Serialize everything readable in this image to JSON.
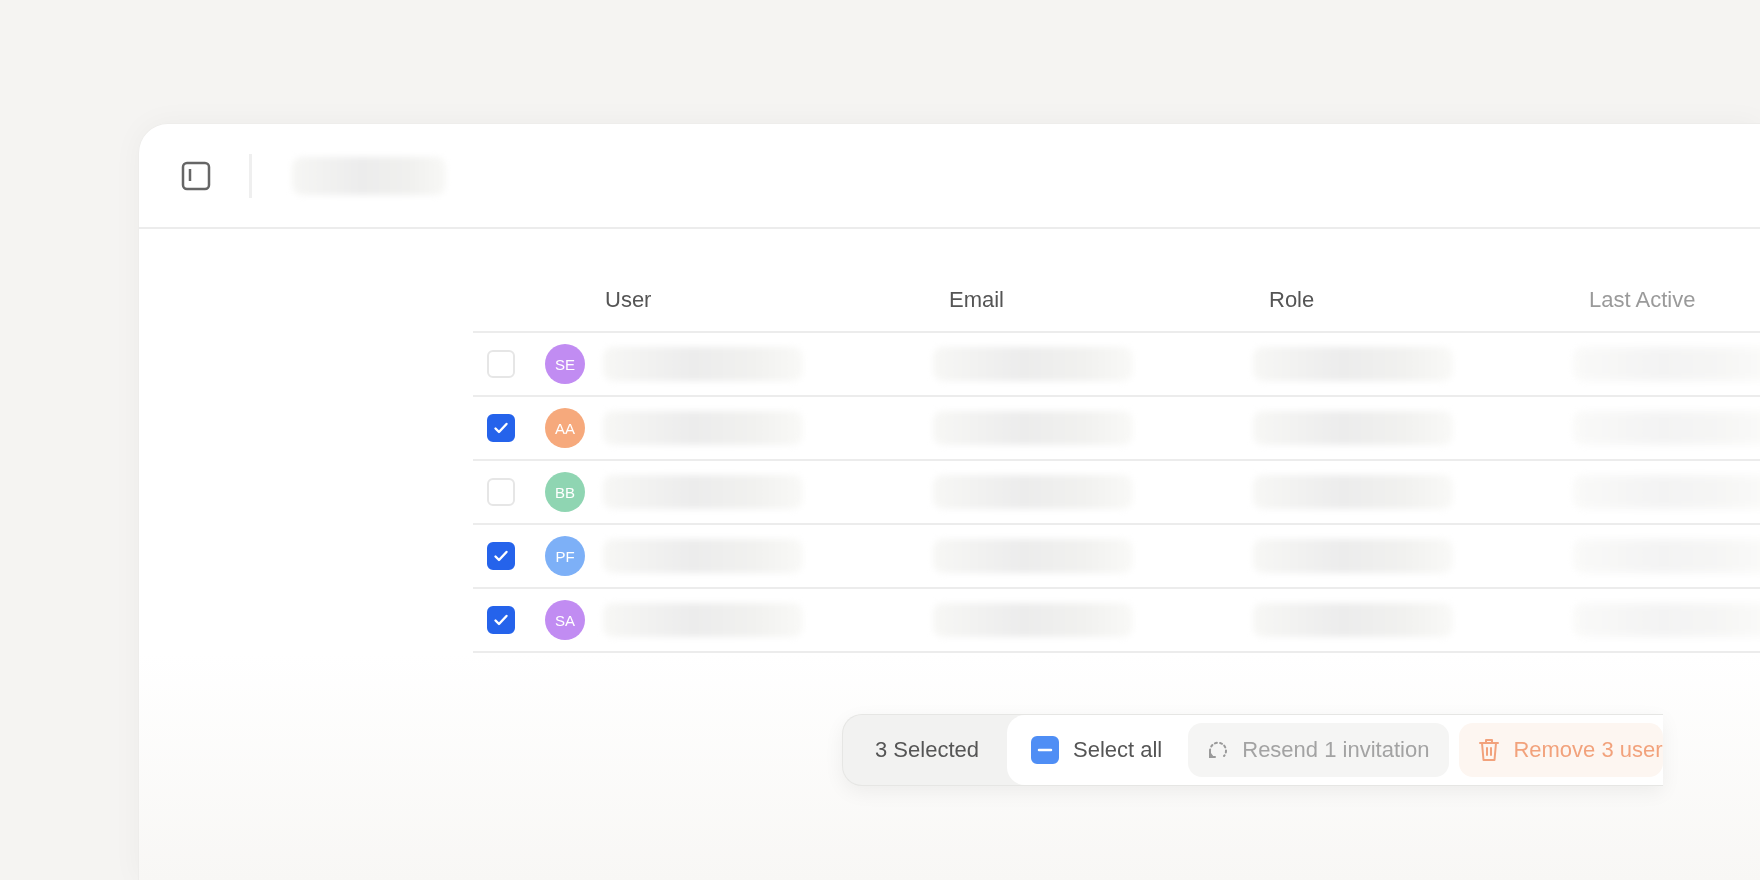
{
  "table": {
    "columns": [
      {
        "label": "User",
        "faded": false
      },
      {
        "label": "Email",
        "faded": false
      },
      {
        "label": "Role",
        "faded": false
      },
      {
        "label": "Last Active",
        "faded": true
      }
    ],
    "rows": [
      {
        "initials": "SE",
        "color": "#c18cf2",
        "checked": false
      },
      {
        "initials": "AA",
        "color": "#f6a97c",
        "checked": true
      },
      {
        "initials": "BB",
        "color": "#8fd5b2",
        "checked": false
      },
      {
        "initials": "PF",
        "color": "#7db0f7",
        "checked": true
      },
      {
        "initials": "SA",
        "color": "#c18cf2",
        "checked": true
      }
    ]
  },
  "selection_bar": {
    "count": "3 Selected",
    "select_all": {
      "label": "Select all",
      "indeterminate": true
    },
    "actions": [
      {
        "kind": "resend",
        "label": "Resend 1 invitation"
      },
      {
        "kind": "remove",
        "label": "Remove 3 user"
      }
    ]
  }
}
